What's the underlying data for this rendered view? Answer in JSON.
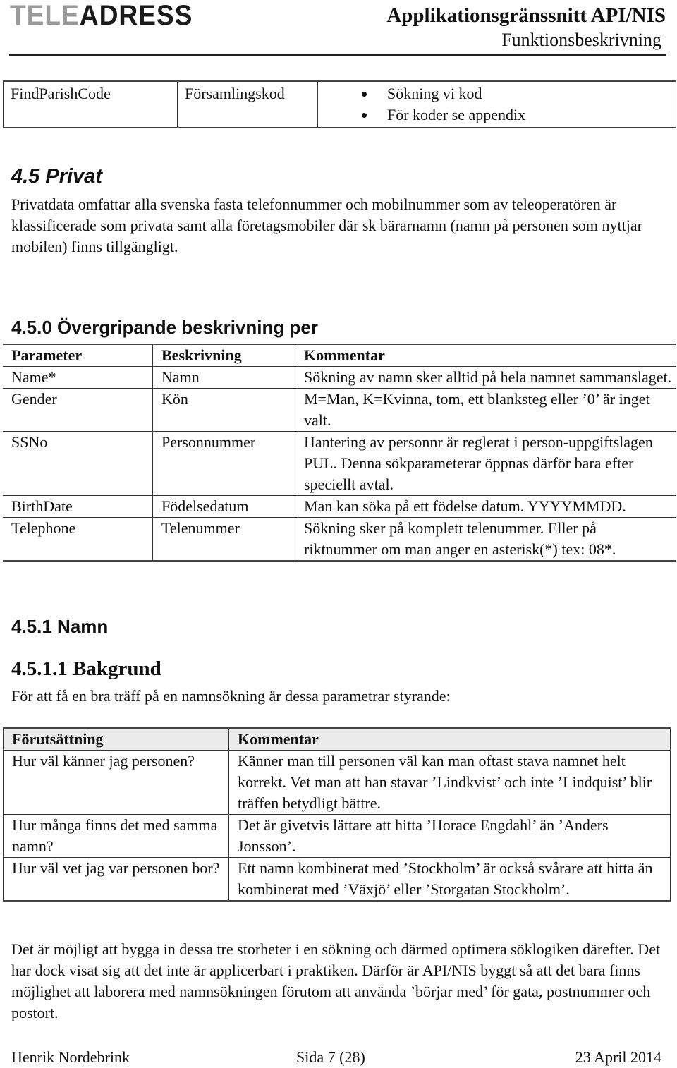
{
  "header": {
    "logo_part1": "TELE",
    "logo_part2": "ADRESS",
    "title": "Applikationsgränssnitt API/NIS",
    "subtitle": "Funktionsbeskrivning"
  },
  "top_table": {
    "rows": [
      {
        "parameter": "FindParishCode",
        "description": "Församlingskod",
        "bullets": [
          "Sökning vi kod",
          "För koder se appendix"
        ]
      }
    ]
  },
  "section_4_5": {
    "heading": "4.5  Privat",
    "paragraph": "Privatdata omfattar alla svenska fasta telefonnummer och mobilnummer som av teleoperatören är klassificerade som privata samt alla företagsmobiler där sk bärarnamn (namn på personen som nyttjar mobilen) finns tillgängligt."
  },
  "section_4_5_0": {
    "heading": "4.5.0  Övergripande beskrivning per",
    "table": {
      "headers": [
        "Parameter",
        "Beskrivning",
        "Kommentar"
      ],
      "rows": [
        [
          "Name*",
          "Namn",
          "Sökning av namn sker alltid på hela namnet sammanslaget."
        ],
        [
          "Gender",
          "Kön",
          "M=Man, K=Kvinna, tom, ett blanksteg eller ’0’ är inget valt."
        ],
        [
          "SSNo",
          "Personnummer",
          "Hantering av personnr är reglerat  i person-uppgiftslagen PUL. Denna sökparameterar öppnas därför bara efter speciellt avtal."
        ],
        [
          "BirthDate",
          "Födelsedatum",
          "Man kan söka på ett födelse datum. YYYYMMDD."
        ],
        [
          "Telephone",
          "Telenummer",
          "Sökning sker på komplett telenummer. Eller på riktnummer om man anger en asterisk(*) tex: 08*."
        ]
      ]
    }
  },
  "section_4_5_1": {
    "heading": "4.5.1  Namn"
  },
  "section_4_5_1_1": {
    "heading": "4.5.1.1 Bakgrund",
    "intro": "För att få en bra träff på en namnsökning är dessa parametrar styrande:",
    "table": {
      "headers": [
        "Förutsättning",
        "Kommentar"
      ],
      "rows": [
        [
          "Hur väl känner jag personen?",
          "Känner man till personen väl kan man oftast stava namnet helt korrekt. Vet man att han stavar ’Lindkvist’ och inte ’Lindquist’ blir träffen betydligt bättre."
        ],
        [
          "Hur många finns det med samma namn?",
          "Det är givetvis lättare att hitta ’Horace Engdahl’ än ’Anders Jonsson’."
        ],
        [
          "Hur väl vet jag var personen bor?",
          "Ett namn kombinerat med ’Stockholm’ är också svårare att hitta än kombinerat med ’Växjö’ eller ’Storgatan Stockholm’."
        ]
      ]
    },
    "conclusion": "Det är möjligt att bygga in dessa tre storheter i en sökning och därmed optimera söklogiken därefter. Det har dock visat sig att det inte är applicerbart i praktiken. Därför är API/NIS byggt så att det bara finns möjlighet att laborera med namnsökningen förutom att använda ’börjar med’ för gata, postnummer och postort."
  },
  "footer": {
    "author": "Henrik Nordebrink",
    "page": "Sida 7 (28)",
    "date": "23 April 2014"
  }
}
